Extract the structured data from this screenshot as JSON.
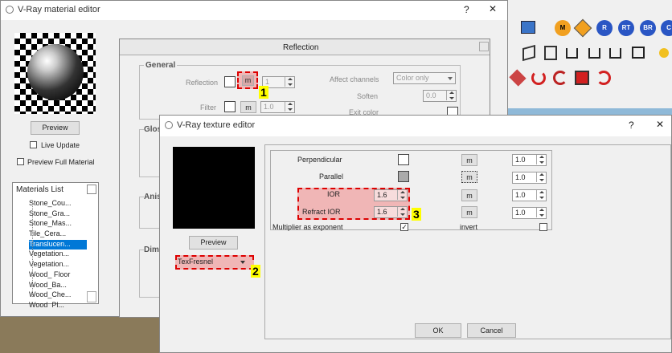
{
  "material_editor": {
    "title": "V-Ray material editor",
    "help": "?",
    "close": "✕",
    "preview_label": "Preview",
    "live_update": "Live Update",
    "preview_full": "Preview Full Material",
    "materials_header": "Materials List",
    "materials": [
      "Stone_Cou...",
      "Stone_Gra...",
      "Stone_Mas...",
      "Tile_Cera...",
      "Translucen...",
      "Vegetation...",
      "Vegetation...",
      "Wood_ Floor",
      "Wood_Ba...",
      "Wood_Che...",
      "Wood_Pl..."
    ],
    "selected_index": 4,
    "reflection_header": "Reflection",
    "general_label": "General",
    "reflection_label": "Reflection",
    "reflection_m": "m",
    "reflection_value": "1",
    "filter_label": "Filter",
    "filter_m": "m",
    "filter_value": "1.0",
    "affect_channels_label": "Affect channels",
    "affect_channels_value": "Color only",
    "soften_label": "Soften",
    "soften_value": "0.0",
    "exit_color_label": "Exit color",
    "glossy_label": "Glos",
    "aniso_label": "Anis",
    "dim_label": "Dim"
  },
  "texture_editor": {
    "title": "V-Ray texture editor",
    "help": "?",
    "close": "✕",
    "preview_label": "Preview",
    "texture_type": "TexFresnel",
    "rows": [
      {
        "label": "Perpendicular",
        "m": "m",
        "value": "1.0"
      },
      {
        "label": "Parallel",
        "m": "m",
        "value": "1.0"
      },
      {
        "label": "IOR",
        "input": "1.6",
        "m": "m",
        "value": "1.0"
      },
      {
        "label": "Refract IOR",
        "input": "1.6",
        "m": "m",
        "value": "1.0"
      }
    ],
    "multiplier_label": "Multiplier as exponent",
    "invert_label": "invert",
    "ok_label": "OK",
    "cancel_label": "Cancel"
  },
  "badges": [
    "1",
    "2",
    "3"
  ],
  "toolbar_icons": {
    "row1": [
      "M",
      "R",
      "RT",
      "BR",
      "C"
    ],
    "colors": {
      "orange": "#f1a020",
      "blue": "#2a56c4",
      "red": "#d22020"
    }
  }
}
